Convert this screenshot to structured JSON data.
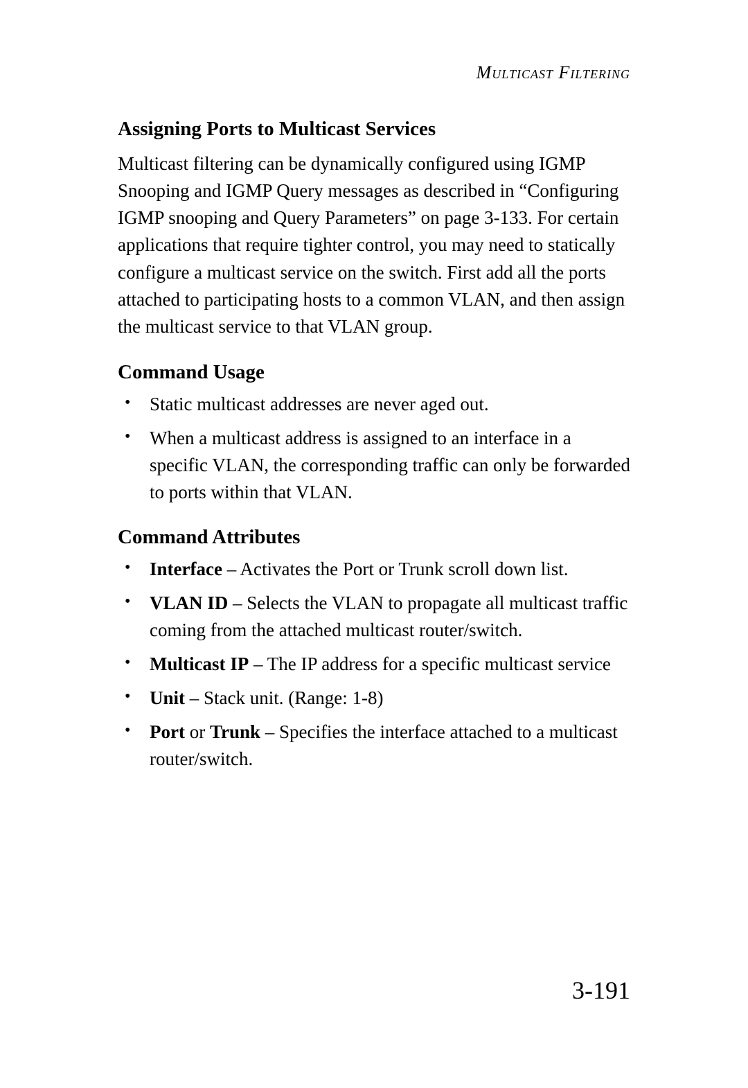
{
  "header": {
    "running_head": "Multicast Filtering"
  },
  "section": {
    "title": "Assigning Ports to Multicast Services",
    "intro": "Multicast filtering can be dynamically configured using IGMP Snooping and IGMP Query messages as described in “Configuring IGMP snooping and Query Parameters” on page 3-133. For certain applications that require tighter control, you may need to statically configure a multicast service on the switch. First add all the ports attached to participating hosts to a common VLAN, and then assign the multicast service to that VLAN group."
  },
  "usage": {
    "heading": "Command Usage",
    "items": [
      "Static multicast addresses are never aged out.",
      "When a multicast address is assigned to an interface in a specific VLAN, the corresponding traffic can only be forwarded to ports within that VLAN."
    ]
  },
  "attributes": {
    "heading": "Command Attributes",
    "items": [
      {
        "term": "Interface",
        "sep": " – ",
        "desc": "Activates the Port or Trunk scroll down list."
      },
      {
        "term": "VLAN ID",
        "sep": " – ",
        "desc": "Selects the VLAN to propagate all multicast traffic coming from the attached multicast router/switch."
      },
      {
        "term": "Multicast IP",
        "sep": " – ",
        "desc": "The IP address for a specific multicast service"
      },
      {
        "term": "Unit",
        "sep": " – ",
        "desc": "Stack unit. (Range: 1-8)"
      },
      {
        "term": "Port",
        "mid": " or ",
        "term2": "Trunk",
        "sep": " – ",
        "desc": "Specifies the interface attached to a multicast router/switch."
      }
    ]
  },
  "page_number": "3-191"
}
